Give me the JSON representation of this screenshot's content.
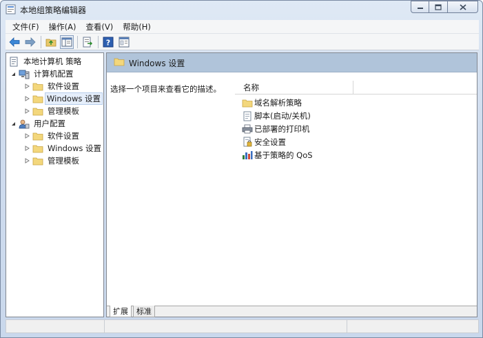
{
  "window": {
    "title": "本地组策略编辑器"
  },
  "menu": [
    {
      "label": "文件(F)"
    },
    {
      "label": "操作(A)"
    },
    {
      "label": "查看(V)"
    },
    {
      "label": "帮助(H)"
    }
  ],
  "toolbar": {
    "buttons": [
      "back-icon",
      "forward-icon",
      "up-folder-icon",
      "show-hide-tree-icon",
      "export-list-icon",
      "help-icon",
      "properties-icon"
    ]
  },
  "tree": {
    "root": "本地计算机 策略",
    "computer_config": "计算机配置",
    "computer_children": [
      "软件设置",
      "Windows 设置",
      "管理模板"
    ],
    "user_config": "用户配置",
    "user_children": [
      "软件设置",
      "Windows 设置",
      "管理模板"
    ],
    "selected": "Windows 设置"
  },
  "details": {
    "header_title": "Windows 设置",
    "description": "选择一个项目来查看它的描述。",
    "column_name": "名称",
    "items": [
      {
        "label": "域名解析策略",
        "icon": "folder-icon"
      },
      {
        "label": "脚本(启动/关机)",
        "icon": "script-icon"
      },
      {
        "label": "已部署的打印机",
        "icon": "printer-icon"
      },
      {
        "label": "安全设置",
        "icon": "security-icon"
      },
      {
        "label": "基于策略的 QoS",
        "icon": "chart-icon"
      }
    ]
  },
  "tabs": [
    {
      "label": "扩展"
    },
    {
      "label": "标准"
    }
  ],
  "colors": {
    "header_band": "#b0c4da",
    "window_frame": "#cfdcee",
    "selection": "#e5eefb"
  }
}
